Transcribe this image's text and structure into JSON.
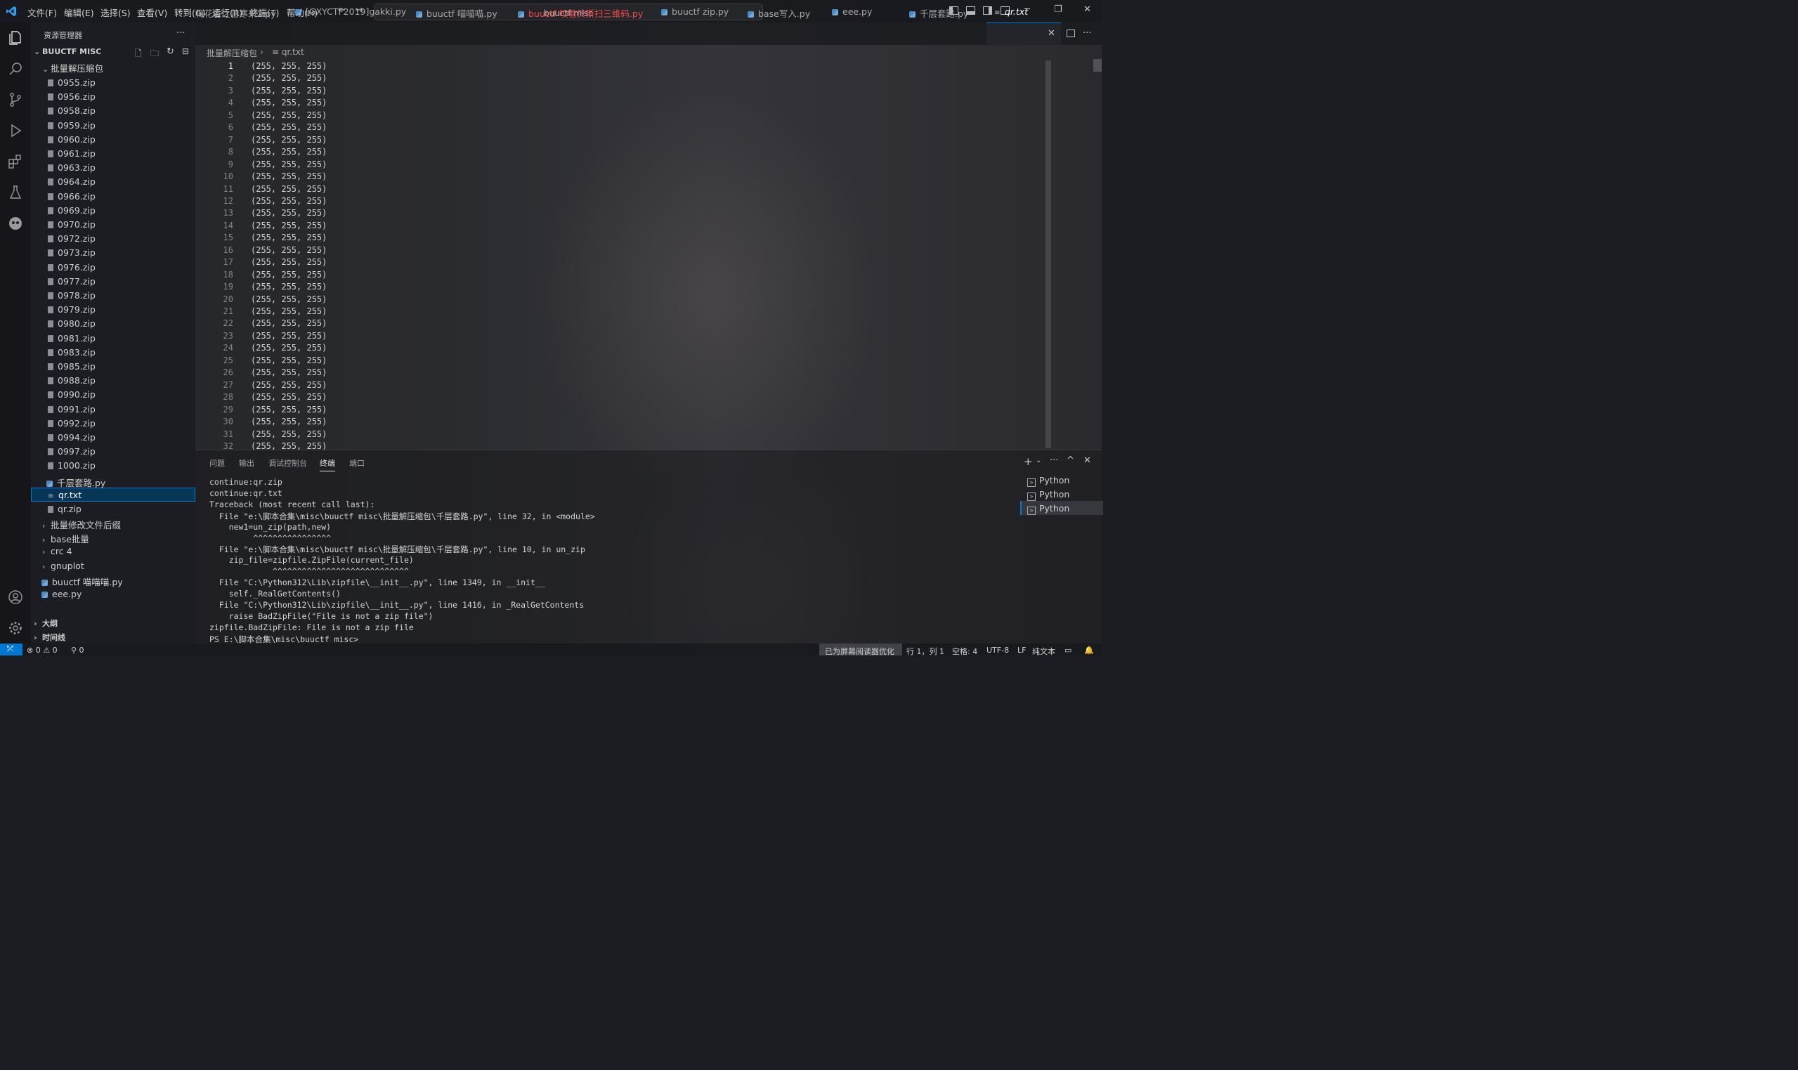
{
  "titlebar": {
    "menu": [
      "文件(F)",
      "编辑(E)",
      "选择(S)",
      "查看(V)",
      "转到(G)",
      "运行(R)",
      "终端(T)",
      "帮助(H)"
    ],
    "search": "buuctf misc"
  },
  "sidebar": {
    "title": "资源管理器",
    "workspace": "BUUCTF MISC",
    "folder_open": "批量解压缩包",
    "files": [
      "0955.zip",
      "0956.zip",
      "0958.zip",
      "0959.zip",
      "0960.zip",
      "0961.zip",
      "0963.zip",
      "0964.zip",
      "0966.zip",
      "0969.zip",
      "0970.zip",
      "0972.zip",
      "0973.zip",
      "0976.zip",
      "0977.zip",
      "0978.zip",
      "0979.zip",
      "0980.zip",
      "0981.zip",
      "0983.zip",
      "0985.zip",
      "0988.zip",
      "0990.zip",
      "0991.zip",
      "0992.zip",
      "0994.zip",
      "0997.zip",
      "1000.zip"
    ],
    "py_file": "千层套路.py",
    "selected_file": "qr.txt",
    "zip_file": "qr.zip",
    "folders": [
      "批量修改文件后缀",
      "base批量",
      "crc 4",
      "gnuplot"
    ],
    "root_files": [
      "buuctf 喵喵喵.py",
      "eee.py"
    ],
    "outline": "大纲",
    "timeline": "时间线"
  },
  "tabs": [
    {
      "label": "梅花香之苦寒来2.py"
    },
    {
      "label": "[GXYCTF2019]gakki.py"
    },
    {
      "label": "buuctf 喵喵喵.py"
    },
    {
      "label": "buuctf 咬着贝斯扫三维码.py",
      "error": true
    },
    {
      "label": "buuctf zip.py"
    },
    {
      "label": "base写入.py"
    },
    {
      "label": "eee.py"
    },
    {
      "label": "千层套路.py"
    },
    {
      "label": "qr.txt",
      "active": true
    }
  ],
  "breadcrumb": {
    "folder": "批量解压缩包",
    "file": "qr.txt"
  },
  "editor": {
    "line_text": "(255, 255, 255)",
    "line_numbers": [
      "1",
      "2",
      "3",
      "4",
      "5",
      "6",
      "7",
      "8",
      "9",
      "10",
      "11",
      "12",
      "13",
      "14",
      "15",
      "16",
      "17",
      "18",
      "19",
      "20",
      "21",
      "22",
      "23",
      "24",
      "25",
      "26",
      "27",
      "28",
      "29",
      "30",
      "31",
      "32"
    ]
  },
  "panel": {
    "tabs": [
      "问题",
      "输出",
      "调试控制台",
      "终端",
      "端口"
    ],
    "active_tab": "终端",
    "terminal_lines": [
      "continue:qr.zip",
      "continue:qr.txt",
      "Traceback (most recent call last):",
      "  File \"e:\\脚本合集\\misc\\buuctf misc\\批量解压缩包\\千层套路.py\", line 32, in <module>",
      "    new1=un_zip(path,new)",
      "         ^^^^^^^^^^^^^^^^",
      "  File \"e:\\脚本合集\\misc\\buuctf misc\\批量解压缩包\\千层套路.py\", line 10, in un_zip",
      "    zip_file=zipfile.ZipFile(current_file)",
      "             ^^^^^^^^^^^^^^^^^^^^^^^^^^^^",
      "  File \"C:\\Python312\\Lib\\zipfile\\__init__.py\", line 1349, in __init__",
      "    self._RealGetContents()",
      "  File \"C:\\Python312\\Lib\\zipfile\\__init__.py\", line 1416, in _RealGetContents",
      "    raise BadZipFile(\"File is not a zip file\")",
      "zipfile.BadZipFile: File is not a zip file",
      "PS E:\\脚本合集\\misc\\buuctf misc>"
    ],
    "terminals": [
      "Python",
      "Python",
      "Python"
    ]
  },
  "statusbar": {
    "problems": "⊗ 0 ⚠ 0",
    "ports": "⚲ 0",
    "screen_reader": "已为屏幕阅读器优化",
    "position": "行 1，列 1",
    "spaces": "空格: 4",
    "encoding": "UTF-8",
    "eol": "LF",
    "language": "纯文本"
  },
  "colors": {
    "accent": "#0078d4",
    "tab_error": "#f14c4c",
    "selection": "#04395e"
  }
}
